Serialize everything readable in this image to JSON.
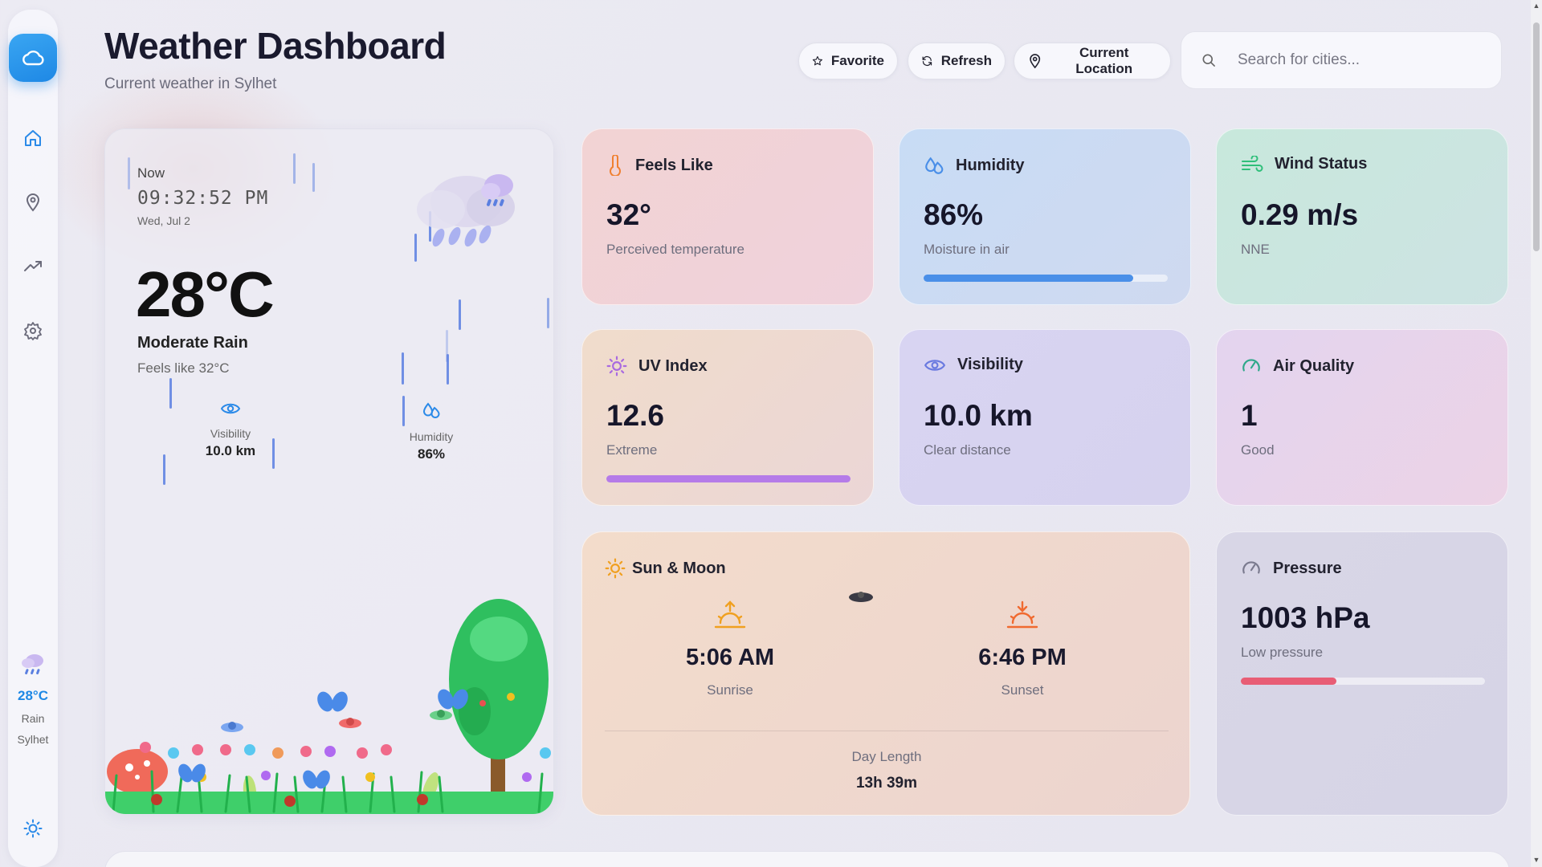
{
  "header": {
    "title": "Weather Dashboard",
    "subtitle": "Current weather in Sylhet",
    "buttons": {
      "favorite": "Favorite",
      "refresh": "Refresh",
      "location": "Current Location"
    },
    "search_placeholder": "Search for cities..."
  },
  "sidebar": {
    "nav_icons": [
      "cloud-logo-icon",
      "home-icon",
      "map-pin-icon",
      "trending-icon",
      "settings-icon"
    ],
    "weather_temp": "28°C",
    "weather_cond": "Rain",
    "weather_city": "Sylhet",
    "theme_icon": "sun-icon"
  },
  "current": {
    "now_label": "Now",
    "clock": "09:32:52 PM",
    "date": "Wed, Jul 2",
    "temperature": "28°C",
    "condition": "Moderate Rain",
    "feels_like": "Feels like 32°C",
    "visibility_label": "Visibility",
    "visibility_value": "10.0 km",
    "humidity_label": "Humidity",
    "humidity_value": "86%"
  },
  "cards": {
    "feels_like": {
      "title": "Feels Like",
      "value": "32°",
      "desc": "Perceived temperature"
    },
    "humidity": {
      "title": "Humidity",
      "value": "86%",
      "desc": "Moisture in air",
      "level": 0.86
    },
    "wind": {
      "title": "Wind Status",
      "value": "0.29 m/s",
      "desc": "NNE"
    },
    "uv": {
      "title": "UV Index",
      "value": "12.6",
      "desc": "Extreme",
      "level": 1.0
    },
    "visibility": {
      "title": "Visibility",
      "value": "10.0 km",
      "desc": "Clear distance"
    },
    "air": {
      "title": "Air Quality",
      "value": "1",
      "desc": "Good"
    },
    "pressure": {
      "title": "Pressure",
      "value": "1003 hPa",
      "desc": "Low pressure",
      "level": 0.39
    }
  },
  "sun_moon": {
    "title": "Sun & Moon",
    "sunrise_time": "5:06 AM",
    "sunrise_label": "Sunrise",
    "sunset_time": "6:46 PM",
    "sunset_label": "Sunset",
    "day_length_label": "Day Length",
    "day_length_value": "13h 39m"
  },
  "colors": {
    "accent": "#1e88e5",
    "humidity_bar": "#4a8fe8",
    "uv_bar": "#b57be8",
    "pressure_bar": "#e85d75"
  }
}
